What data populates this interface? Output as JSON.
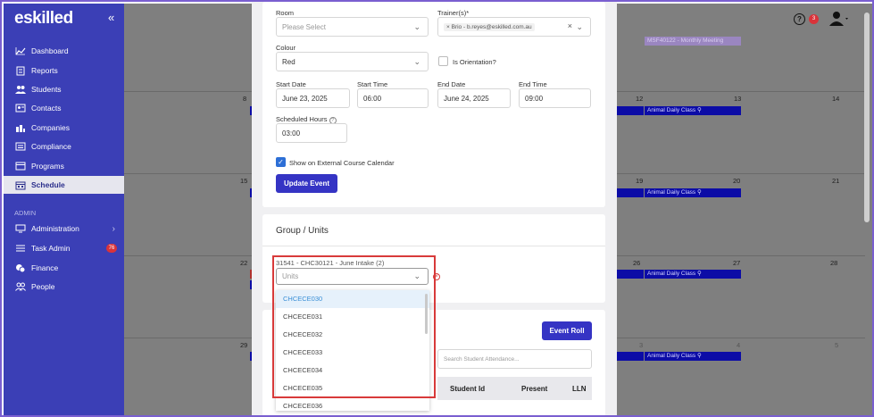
{
  "sidebar": {
    "logo": "eskilled",
    "items": [
      {
        "label": "Dashboard",
        "icon": "chart-line-icon"
      },
      {
        "label": "Reports",
        "icon": "report-icon"
      },
      {
        "label": "Students",
        "icon": "students-icon"
      },
      {
        "label": "Contacts",
        "icon": "contacts-icon"
      },
      {
        "label": "Companies",
        "icon": "companies-icon"
      },
      {
        "label": "Compliance",
        "icon": "compliance-icon"
      },
      {
        "label": "Programs",
        "icon": "programs-icon"
      },
      {
        "label": "Schedule",
        "icon": "calendar-icon"
      }
    ],
    "section_label": "ADMIN",
    "admin_items": [
      {
        "label": "Administration",
        "icon": "monitor-icon"
      },
      {
        "label": "Task Admin",
        "icon": "list-icon",
        "badge": "76"
      },
      {
        "label": "Finance",
        "icon": "coins-icon"
      },
      {
        "label": "People",
        "icon": "people-icon"
      }
    ]
  },
  "header": {
    "notification_count": "3",
    "help": "?"
  },
  "calendar": {
    "rows": [
      {
        "days": [
          "8",
          "",
          "",
          "",
          "",
          "12",
          "13",
          "14"
        ]
      },
      {
        "days": [
          "15",
          "",
          "",
          "",
          "",
          "19",
          "20",
          "21"
        ]
      },
      {
        "days": [
          "22",
          "",
          "",
          "",
          "",
          "26",
          "27",
          "28"
        ]
      },
      {
        "days": [
          "29",
          "",
          "",
          "",
          "",
          "3",
          "4",
          "5"
        ]
      }
    ],
    "events": {
      "top": "MSF40122 - Monthly Meeting",
      "class": "Animal Daily Class"
    }
  },
  "form": {
    "room_label": "Room",
    "room_placeholder": "Please Select",
    "trainer_label": "Trainer(s)*",
    "trainer_chip": "Brio - b.reyes@eskilled.com.au",
    "colour_label": "Colour",
    "colour_value": "Red",
    "orientation_label": "Is Orientation?",
    "start_date_label": "Start Date",
    "start_date": "June 23, 2025",
    "start_time_label": "Start Time",
    "start_time": "06:00",
    "end_date_label": "End Date",
    "end_date": "June 24, 2025",
    "end_time_label": "End Time",
    "end_time": "09:00",
    "hours_label": "Scheduled Hours",
    "hours_value": "03:00",
    "external_label": "Show on External Course Calendar",
    "update_button": "Update Event"
  },
  "groups": {
    "title": "Group / Units",
    "group_label": "31541 - CHC30121 - June Intake (2)",
    "units_placeholder": "Units",
    "options": [
      "CHCECE030",
      "CHCECE031",
      "CHCECE032",
      "CHCECE033",
      "CHCECE034",
      "CHCECE035",
      "CHCECE036"
    ]
  },
  "attendance": {
    "event_roll": "Event Roll",
    "search_placeholder": "Search Student Attendance...",
    "columns": [
      "Student Id",
      "Present",
      "LLN"
    ]
  }
}
